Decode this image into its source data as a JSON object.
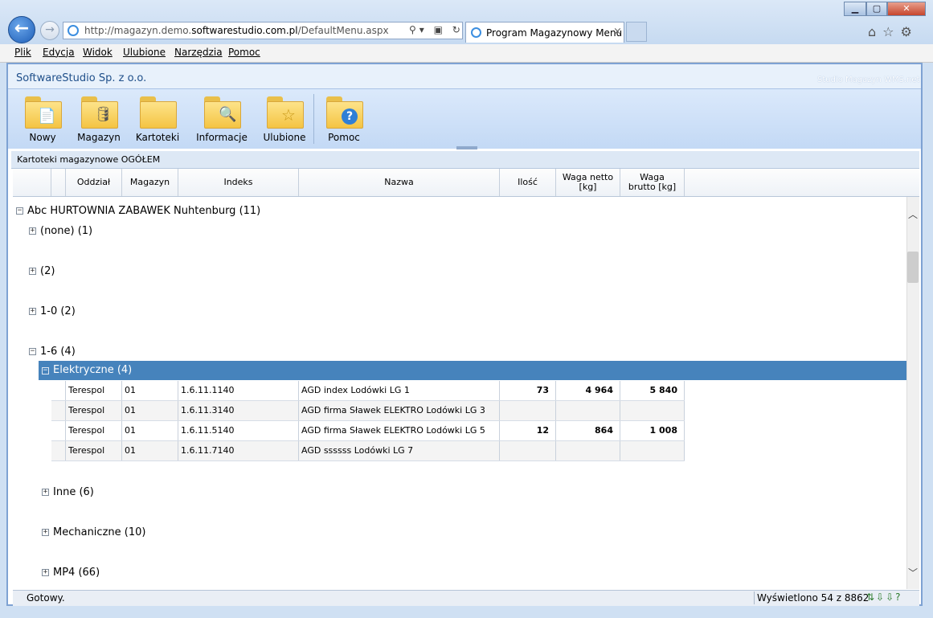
{
  "browser": {
    "address_prefix": "http://magazyn.demo.",
    "address_domain": "softwarestudio.com.pl",
    "address_path": "/DefaultMenu.aspx",
    "tab_title": "Program Magazynowy Menu",
    "tab_close": "×",
    "back_glyph": "←",
    "forward_glyph": "→",
    "addr_icons": "⚲▾ ▣ ↻",
    "window_buttons": {
      "min": "▁",
      "max": "▢",
      "close": "✕"
    },
    "tools_glyphs": "⌂☆⚙"
  },
  "menu": [
    "Plik",
    "Edycja",
    "Widok",
    "Ulubione",
    "Narzędzia",
    "Pomoc"
  ],
  "app": {
    "company": "SoftwareStudio Sp. z o.o.",
    "product": "Studio Magazyn WMS.net"
  },
  "ribbon": {
    "buttons": [
      {
        "label": "Nowy",
        "icon": "new-document-icon",
        "glyph": "📄"
      },
      {
        "label": "Magazyn",
        "icon": "database-icon",
        "glyph": "🛢"
      },
      {
        "label": "Kartoteki",
        "icon": "folder-icon",
        "glyph": ""
      },
      {
        "label": "Informacje",
        "icon": "search-icon",
        "glyph": "🔍"
      },
      {
        "label": "Ulubione",
        "icon": "star-icon",
        "glyph": "☆"
      },
      {
        "label": "Pomoc",
        "icon": "help-icon",
        "glyph": "?"
      }
    ]
  },
  "grid": {
    "title": "Kartoteki magazynowe OGÓŁEM",
    "columns": [
      "Oddział",
      "Magazyn",
      "Indeks",
      "Nazwa",
      "Ilość",
      "Waga netto [kg]",
      "Waga brutto [kg]"
    ],
    "root_group": "Abc HURTOWNIA ZABAWEK Nuhtenburg (11)",
    "groups": [
      "(none) (1)",
      "(2)",
      "1-0 (2)",
      "1-6 (4)"
    ],
    "selected_group": "Elektryczne (4)",
    "rows": [
      {
        "oddzial": "Terespol",
        "magazyn": "01",
        "indeks": "1.6.11.1140",
        "nazwa": "AGD index Lodówki LG 1",
        "ilosc": "73",
        "netto": "4 964",
        "brutto": "5 840"
      },
      {
        "oddzial": "Terespol",
        "magazyn": "01",
        "indeks": "1.6.11.3140",
        "nazwa": "AGD firma Sławek ELEKTRO Lodówki LG 3",
        "ilosc": "",
        "netto": "",
        "brutto": ""
      },
      {
        "oddzial": "Terespol",
        "magazyn": "01",
        "indeks": "1.6.11.5140",
        "nazwa": "AGD firma Sławek ELEKTRO Lodówki LG 5",
        "ilosc": "12",
        "netto": "864",
        "brutto": "1 008"
      },
      {
        "oddzial": "Terespol",
        "magazyn": "01",
        "indeks": "1.6.11.7140",
        "nazwa": "AGD ssssss Lodówki LG 7",
        "ilosc": "",
        "netto": "",
        "brutto": ""
      }
    ],
    "subgroups": [
      "Inne (6)",
      "Mechaniczne (10)",
      "MP4 (66)"
    ],
    "expand_glyph": "+",
    "collapse_glyph": "−",
    "scroll_up": "︿",
    "scroll_down": "﹀"
  },
  "status": {
    "left": "Gotowy.",
    "right": "Wyświetlono 54 z 8862",
    "icons": "⇅⇩⇩?"
  }
}
